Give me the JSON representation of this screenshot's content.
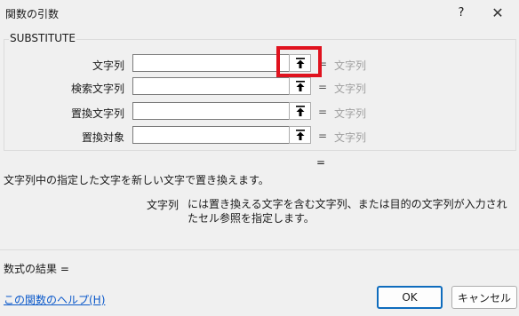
{
  "window": {
    "title": "関数の引数",
    "help_glyph": "?",
    "close_glyph": "✕"
  },
  "function": {
    "name": "SUBSTITUTE",
    "args": [
      {
        "label": "文字列",
        "value": "",
        "equals": "=",
        "hint": "文字列"
      },
      {
        "label": "検索文字列",
        "value": "",
        "equals": "=",
        "hint": "文字列"
      },
      {
        "label": "置換文字列",
        "value": "",
        "equals": "=",
        "hint": "文字列"
      },
      {
        "label": "置換対象",
        "value": "",
        "equals": "=",
        "hint": "文字列"
      }
    ],
    "result_equals": "=",
    "description": "文字列中の指定した文字を新しい文字で置き換えます。",
    "arg_description_name": "文字列",
    "arg_description_text": "には置き換える文字を含む文字列、または目的の文字列が入力されたセル参照を指定します。"
  },
  "formula_result": "数式の結果 =",
  "help_link": "この関数のヘルプ(H)",
  "buttons": {
    "ok": "OK",
    "cancel": "キャンセル"
  },
  "icons": {
    "ref_button": "collapse-dialog-arrow-icon",
    "close": "close-icon",
    "help": "help-icon"
  },
  "colors": {
    "highlight": "#e0121e",
    "link": "#0a58ca",
    "hint_text": "#a0a0a0",
    "ok_border": "#0f6cbd"
  }
}
